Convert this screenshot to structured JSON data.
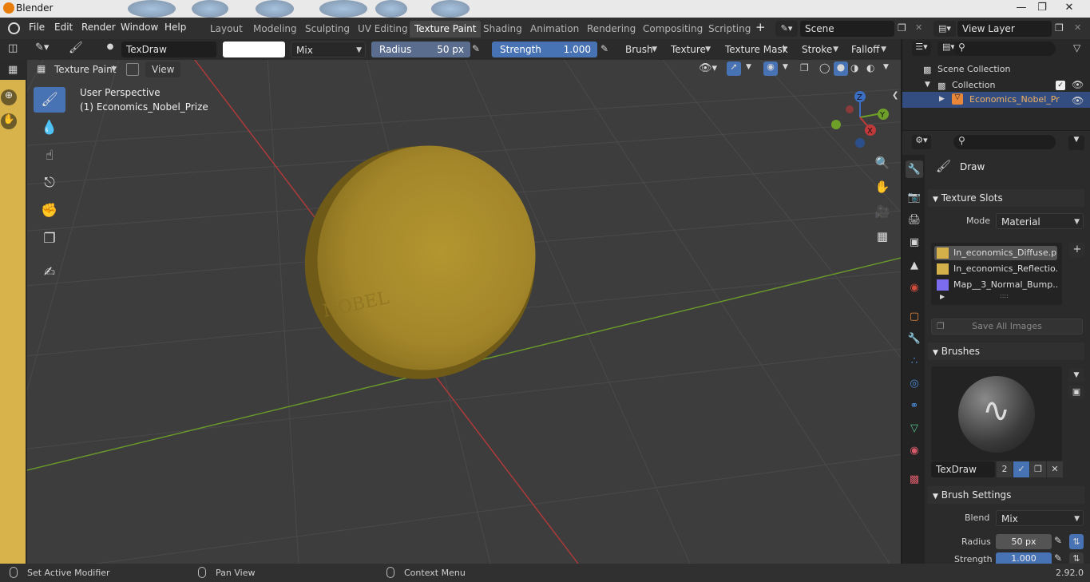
{
  "window": {
    "title": "Blender"
  },
  "menu": {
    "file": "File",
    "edit": "Edit",
    "render": "Render",
    "window": "Window",
    "help": "Help"
  },
  "workspaces": [
    "Layout",
    "Modeling",
    "Sculpting",
    "UV Editing",
    "Texture Paint",
    "Shading",
    "Animation",
    "Rendering",
    "Compositing",
    "Scripting"
  ],
  "active_workspace": "Texture Paint",
  "scene": {
    "name": "Scene",
    "view_layer": "View Layer"
  },
  "tool_header": {
    "brush_name": "TexDraw",
    "blend": "Mix",
    "radius_label": "Radius",
    "radius_value": "50 px",
    "strength_label": "Strength",
    "strength_value": "1.000",
    "brush_menu": "Brush",
    "texture_menu": "Texture",
    "texture_mask_menu": "Texture Mask",
    "stroke_menu": "Stroke",
    "falloff_menu": "Falloff"
  },
  "viewport_header": {
    "mode": "Texture Paint",
    "view": "View"
  },
  "viewport": {
    "perspective": "User Perspective",
    "object": "(1) Economics_Nobel_Prize",
    "coin_color": "#a88a2c"
  },
  "gizmo": {
    "z": "Z",
    "y": "Y",
    "x": "X"
  },
  "outliner": {
    "scene_collection": "Scene Collection",
    "collection": "Collection",
    "object": "Economics_Nobel_Pr"
  },
  "properties": {
    "tool_name": "Draw",
    "texture_slots": {
      "header": "Texture Slots",
      "mode_label": "Mode",
      "mode_value": "Material",
      "slots": [
        {
          "name": "In_economics_Diffuse.p...",
          "color": "#d4b04a"
        },
        {
          "name": "In_economics_Reflectio...",
          "color": "#d4b04a"
        },
        {
          "name": "Map__3_Normal_Bump....",
          "color": "#7b6cf0"
        }
      ],
      "save_all": "Save All Images"
    },
    "brushes": {
      "header": "Brushes",
      "brush_name": "TexDraw",
      "users": "2"
    },
    "brush_settings": {
      "header": "Brush Settings",
      "blend_label": "Blend",
      "blend_value": "Mix",
      "radius_label": "Radius",
      "radius_value": "50 px",
      "strength_label": "Strength",
      "strength_value": "1.000"
    }
  },
  "status_bar": {
    "left": "Set Active Modifier",
    "middle": "Pan View",
    "right": "Context Menu",
    "version": "2.92.0"
  },
  "colors": {
    "accent": "#4772b3",
    "x_axis": "#c0393b",
    "y_axis": "#6e9f29",
    "z_axis": "#3c6fc4"
  }
}
